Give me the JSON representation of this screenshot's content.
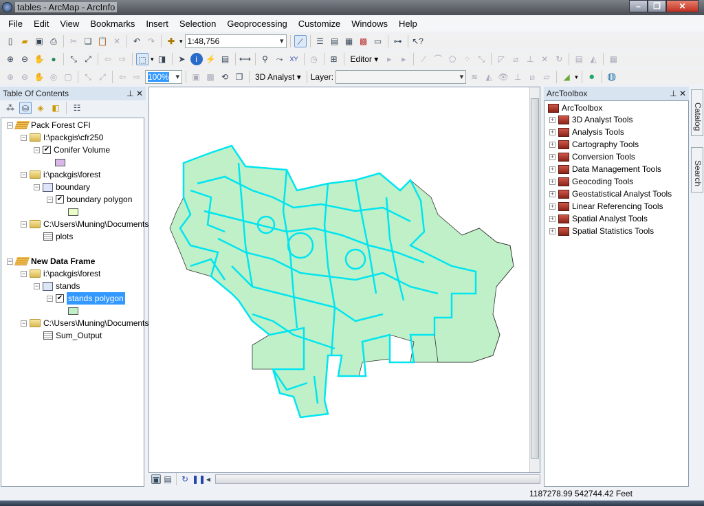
{
  "window": {
    "title": "tables - ArcMap - ArcInfo"
  },
  "menu": [
    "File",
    "Edit",
    "View",
    "Bookmarks",
    "Insert",
    "Selection",
    "Geoprocessing",
    "Customize",
    "Windows",
    "Help"
  ],
  "toolbar": {
    "scale": "1:48,756",
    "zoom_percent": "100%",
    "analyst_label": "3D Analyst",
    "layer_label": "Layer:",
    "layer_value": "",
    "editor_label": "Editor"
  },
  "toc": {
    "title": "Table Of Contents",
    "items": [
      {
        "label": "Pack Forest CFI"
      },
      {
        "label": "I:\\packgis\\cfr250"
      },
      {
        "label": "Conifer Volume"
      },
      {
        "label": "i:\\packgis\\forest"
      },
      {
        "label": "boundary"
      },
      {
        "label": "boundary polygon"
      },
      {
        "label": "C:\\Users\\Muning\\Documents"
      },
      {
        "label": "plots"
      },
      {
        "label": "New Data Frame"
      },
      {
        "label": "i:\\packgis\\forest"
      },
      {
        "label": "stands"
      },
      {
        "label": "stands polygon"
      },
      {
        "label": "C:\\Users\\Muning\\Documents"
      },
      {
        "label": "Sum_Output"
      }
    ],
    "colors": {
      "conifer": "#d9b8e8",
      "boundary": "#eaffc8",
      "stands": "#bff0c8",
      "selection": "#3399ff"
    }
  },
  "toolbox": {
    "title": "ArcToolbox",
    "root": "ArcToolbox",
    "items": [
      "3D Analyst Tools",
      "Analysis Tools",
      "Cartography Tools",
      "Conversion Tools",
      "Data Management Tools",
      "Geocoding Tools",
      "Geostatistical Analyst Tools",
      "Linear Referencing Tools",
      "Spatial Analyst Tools",
      "Spatial Statistics Tools"
    ]
  },
  "side_tabs": [
    "Catalog",
    "Search"
  ],
  "map": {
    "fill": "#bff0c8",
    "outline": "#00e5f0"
  },
  "status": {
    "coordinates": "1187278.99  542744.42 Feet"
  }
}
